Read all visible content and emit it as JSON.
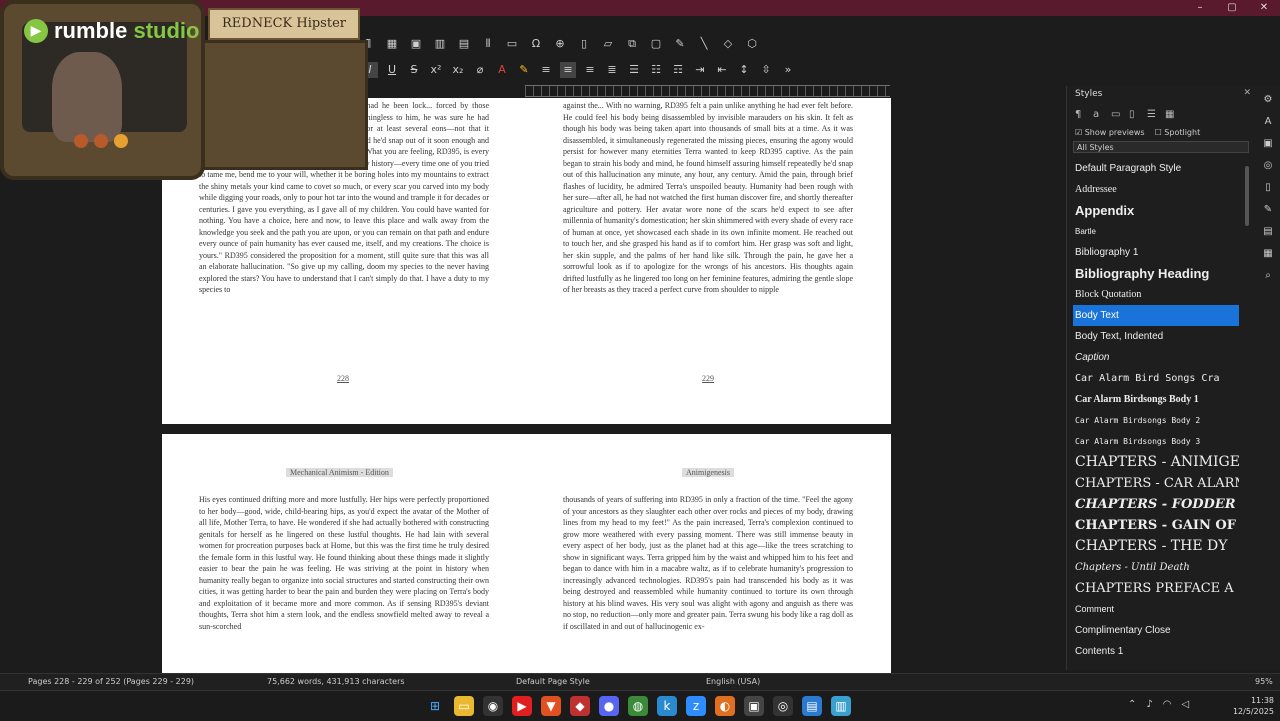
{
  "window": {
    "minimize": "–",
    "maximize": "▢",
    "close": "✕"
  },
  "overlay": {
    "rumble_word": "rumble",
    "rumble_studio": "studio",
    "brand_plate": "REDNECK Hipster"
  },
  "toolbar": {
    "bold": "B",
    "italic": "I",
    "underline": "U",
    "strike": "S",
    "superscript": "x²",
    "subscript": "x₂"
  },
  "document": {
    "page_top_left": {
      "text": "RD395 felt despair, pain, and agony. How long had he been lock... forced by those iridescent pools? Time had continued to be... meaningless to him, he was sure he had existed here on this plane with... Terra present for at least several eons—not that it mattered. It was all just a hallucination, after all, and he'd snap out of it soon enough and find out what knowledge was hidden behind the... \"What you are feeling, RD395, is every malicious act you, species has foisted upon me in my history—every time one of you tried to tame me, bend me to your will, whether it be boring holes into my mountains to extract the shiny metals your kind came to covet so much, or every scar you carved into my body while digging your roads, only to pour hot tar into the wound and trample it for decades or centuries. I gave you everything, as I gave all of my children. You could have wanted for nothing. You have a choice, here and now, to leave this place and walk away from the knowledge you seek and the path you are upon, or you can remain on that path and endure every ounce of pain humanity has ever caused me, itself, and my creations. The choice is yours.\" RD395 considered the proposition for a moment, still quite sure that this was all an elaborate hallucination. \"So give up my calling, doom my species to the never having explored the stars? You have to understand that I can't simply do that. I have a duty to my species to",
      "page_number": "228"
    },
    "page_top_right": {
      "text": "against the... With no warning, RD395 felt a pain unlike anything he had ever felt before. He could feel his body being disassembled by invisible marauders on his skin. It felt as though his body was being taken apart into thousands of small bits at a time. As it was disassembled, it simultaneously regenerated the missing pieces, ensuring the agony would persist for however many eternities Terra wanted to keep RD395 captive. As the pain began to strain his body and mind, he found himself assuring himself repeatedly he'd snap out of this hallucination any minute, any hour, any century. Amid the pain, through brief flashes of lucidity, he admired Terra's unspoiled beauty. Humanity had been rough with her sure—after all, he had not watched the first human discover fire, and shortly thereafter agriculture and pottery. Her avatar wore none of the scars he'd expect to see after millennia of humanity's domestication; her skin shimmered with every shade of every race of human at once, yet showcased each shade in its own infinite moment. He reached out to touch her, and she grasped his hand as if to comfort him. Her grasp was soft and light, her skin supple, and the palms of her hand like silk. Through the pain, he gave her a sorrowful look as if to apologize for the wrongs of his ancestors. His thoughts again drifted lustfully as he lingered too long on her feminine features, admiring the gentle slope of her breasts as they traced a perfect curve from shoulder to nipple",
      "page_number": "229"
    },
    "page_bottom_left": {
      "running_head": "Mechanical Animism - Edition",
      "text": "His eyes continued drifting more and more lustfully. Her hips were perfectly proportioned to her body—good, wide, child-bearing hips, as you'd expect the avatar of the Mother of all life, Mother Terra, to have. He wondered if she had actually bothered with constructing genitals for herself as he lingered on these lustful thoughts. He had lain with several women for procreation purposes back at Home, but this was the first time he truly desired the female form in this lustful way. He found thinking about these things made it slightly easier to bear the pain he was feeling. He was striving at the point in history when humanity really began to organize into social structures and started constructing their own cities, it was getting harder to bear the pain and burden they were placing on Terra's body and exploitation of it became more and more common. As if sensing RD395's deviant thoughts, Terra shot him a stern look, and the endless snowfield melted away to reveal a sun-scorched"
    },
    "page_bottom_right": {
      "running_head": "Animigenesis",
      "text": "thousands of years of suffering into RD395 in only a fraction of the time. \"Feel the agony of your ancestors as they slaughter each other over rocks and pieces of my body, drawing lines from my head to my feet!\" As the pain increased, Terra's complexion continued to grow more weathered with every passing moment. There was still immense beauty in every aspect of her body, just as the planet had at this age—like the trees scratching to show in significant ways. Terra gripped him by the waist and whipped him to his feet and began to dance with him in a macabre waltz, as if to celebrate humanity's progression to increasingly advanced technologies. RD395's pain had transcended his body as it was being destroyed and reassembled while humanity continued to torture its own through history at his blind waves. His very soul was alight with agony and anguish as there was no stop, no reduction—only more and greater pain. Terra swung his body like a rag doll as if oscillated in and out of hallucinogenic ex-"
    }
  },
  "styles_panel": {
    "title": "Styles",
    "show_previews": "Show previews",
    "spotlight": "Spotlight",
    "filter": "All Styles",
    "items": [
      "Default Paragraph Style",
      "Addressee",
      "Appendix",
      "Bartle",
      "Bibliography 1",
      "Bibliography Heading",
      "Block Quotation",
      "Body Text",
      "Body Text, Indented",
      "Caption",
      "Car Alarm Bird Songs Cra",
      "Car Alarm Birdsongs Body 1",
      "Car Alarm Birdsongs Body 2",
      "Car Alarm Birdsongs Body 3",
      "CHAPTERS - ANIMIGE",
      "CHAPTERS - CAR ALARM",
      "CHAPTERS - FODDER",
      "CHAPTERS - GAIN OF FU",
      "CHAPTERS - THE DY",
      "Chapters - Until Death",
      "CHAPTERS PREFACE A",
      "Comment",
      "Complimentary Close",
      "Contents 1"
    ],
    "selected": "Body Text"
  },
  "statusbar": {
    "pages": "Pages 228 - 229 of 252 (Pages 229 - 229)",
    "words": "75,662 words, 431,913 characters",
    "page_style": "Default Page Style",
    "language": "English (USA)",
    "zoom": "95%"
  },
  "tray": {
    "time": "11:38",
    "date": "12/5/2025"
  }
}
